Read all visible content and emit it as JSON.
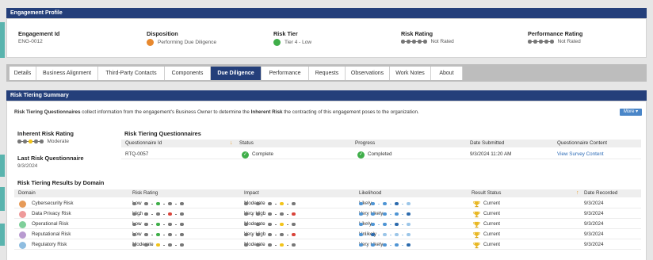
{
  "colors": {
    "navy": "#243f7a",
    "teal": "#5ab4ae",
    "green": "#3fae49",
    "orange": "#e8892e",
    "red": "#d9443b",
    "yellow": "#f2c41b",
    "link": "#2a6ab6"
  },
  "profile": {
    "title": "Engagement Profile",
    "fields": [
      {
        "label": "Engagement Id",
        "value": "ENG-0012"
      },
      {
        "label": "Disposition",
        "value": "Performing Due Diligence",
        "icon": "orange-circle-icon"
      },
      {
        "label": "Risk Tier",
        "value": "Tier 4 - Low",
        "icon": "green-circle-icon"
      },
      {
        "label": "Risk Rating",
        "value": "Not Rated",
        "icon": "rating-dots-icon"
      },
      {
        "label": "Performance Rating",
        "value": "Not Rated",
        "icon": "rating-dots-icon"
      }
    ]
  },
  "tabs": [
    {
      "label": "Details"
    },
    {
      "label": "Business Alignment"
    },
    {
      "label": "Third-Party Contacts"
    },
    {
      "label": "Components"
    },
    {
      "label": "Due Diligence",
      "active": true
    },
    {
      "label": "Performance"
    },
    {
      "label": "Requests"
    },
    {
      "label": "Observations"
    },
    {
      "label": "Work Notes"
    },
    {
      "label": "About"
    }
  ],
  "summary": {
    "title": "Risk Tiering Summary",
    "intro": {
      "lead": "Risk Tiering Questionnaires",
      "mid": " collect information from the engagement's Business Owner to determine the ",
      "bold2": "Inherent Risk",
      "tail": " the contracting of this engagement poses to the organization."
    },
    "more_label": "More ▾",
    "inherent_label": "Inherent Risk Rating",
    "inherent_value": "Moderate",
    "last_q_label": "Last Risk Questionnaire",
    "last_q_value": "9/3/2024",
    "questionnaires": {
      "title": "Risk Tiering Questionnaires",
      "headers": [
        "Questionnaire Id",
        "Status",
        "Progress",
        "Date Submitted",
        "Questionnaire Content"
      ],
      "row": {
        "id": "RTQ-0057",
        "status": "Complete",
        "progress": "Completed",
        "date": "9/3/2024 11:20 AM",
        "content": "View Survey Content"
      }
    },
    "domains": {
      "title": "Risk Tiering Results by Domain",
      "headers": [
        "Domain",
        "Risk Rating",
        "Impact",
        "Likelihood",
        "Result Status",
        "Date Recorded"
      ],
      "rows": [
        {
          "domain": "Cybersecurity Risk",
          "color": "#e69a58",
          "rating": "Low",
          "impact": "Moderate",
          "likelihood": "Likely",
          "status": "Current",
          "date": "9/3/2024"
        },
        {
          "domain": "Data Privacy Risk",
          "color": "#ee9a9a",
          "rating": "High",
          "impact": "Very High",
          "likelihood": "Very Likely",
          "status": "Current",
          "date": "9/3/2024"
        },
        {
          "domain": "Operational Risk",
          "color": "#7fcf9a",
          "rating": "Low",
          "impact": "Moderate",
          "likelihood": "Likely",
          "status": "Current",
          "date": "9/3/2024"
        },
        {
          "domain": "Reputational Risk",
          "color": "#b89ad0",
          "rating": "Low",
          "impact": "Very High",
          "likelihood": "Unlikely",
          "status": "Current",
          "date": "9/3/2024"
        },
        {
          "domain": "Regulatory Risk",
          "color": "#8fbde0",
          "rating": "Moderate",
          "impact": "Moderate",
          "likelihood": "Very Likely",
          "status": "Current",
          "date": "9/3/2024"
        }
      ]
    }
  }
}
